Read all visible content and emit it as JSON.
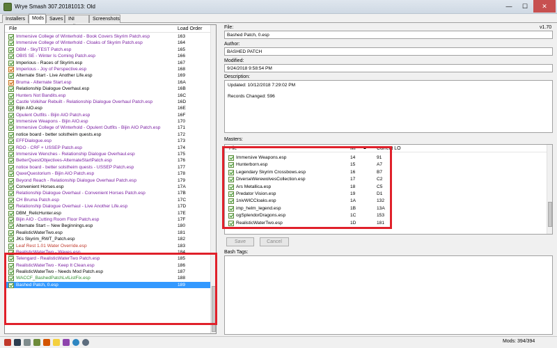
{
  "window": {
    "title": "Wrye Smash 307.20181013: Old",
    "min": "—",
    "max": "☐",
    "close": "✕"
  },
  "tabs": [
    "Installers",
    "Mods",
    "Saves",
    "INI Edits",
    "Screenshots"
  ],
  "list": {
    "col_file": "File",
    "col_lo": "Load Order",
    "rows": [
      {
        "name": "Immersive College of Winterhold - Book Covers Skyrim Patch.esp",
        "lo": "163",
        "color": "#7a1fa2",
        "check": "green"
      },
      {
        "name": "Immersive College of Winterhold - Cloaks of Skyrim Patch.esp",
        "lo": "164",
        "color": "#7a1fa2",
        "check": "green"
      },
      {
        "name": "DBM - SkyTEST Patch.esp",
        "lo": "165",
        "color": "#7a1fa2",
        "check": "green"
      },
      {
        "name": "OBIS SE - Winter Is Coming Patch.esp",
        "lo": "166",
        "color": "#7a1fa2",
        "check": "green"
      },
      {
        "name": "Imperious - Races of Skyrim.esp",
        "lo": "167",
        "color": "#000000",
        "check": "green"
      },
      {
        "name": "Imperious - Joy of Perspective.esp",
        "lo": "168",
        "color": "#7a1fa2",
        "check": "orange"
      },
      {
        "name": "Alternate Start - Live Another Life.esp",
        "lo": "169",
        "color": "#000000",
        "check": "green"
      },
      {
        "name": "Bruma - Alternate Start.esp",
        "lo": "16A",
        "color": "#7a1fa2",
        "check": "orange"
      },
      {
        "name": "Relationship Dialogue Overhaul.esp",
        "lo": "16B",
        "color": "#000000",
        "check": "green"
      },
      {
        "name": "Hunters Not Bandits.esp",
        "lo": "16C",
        "color": "#7a1fa2",
        "check": "green"
      },
      {
        "name": "Castle Volkihar Rebuilt - Relationship Dialogue Overhaul Patch.esp",
        "lo": "16D",
        "color": "#7a1fa2",
        "check": "green"
      },
      {
        "name": "Bijin AIO.esp",
        "lo": "16E",
        "color": "#000000",
        "check": "green"
      },
      {
        "name": "Opulent Outfits - Bijin AIO Patch.esp",
        "lo": "16F",
        "color": "#7a1fa2",
        "check": "green"
      },
      {
        "name": "Immersive Weapons - Bijin AIO.esp",
        "lo": "170",
        "color": "#7a1fa2",
        "check": "green"
      },
      {
        "name": "Immersive College of Winterhold - Opulent Outfits - Bijin AIO Patch.esp",
        "lo": "171",
        "color": "#7a1fa2",
        "check": "green"
      },
      {
        "name": "notice board - better solstheim quests.esp",
        "lo": "172",
        "color": "#000000",
        "check": "green"
      },
      {
        "name": "EFFDialogue.esp",
        "lo": "173",
        "color": "#7a1fa2",
        "check": "green"
      },
      {
        "name": "RDO - CRF + USSEP Patch.esp",
        "lo": "174",
        "color": "#7a1fa2",
        "check": "green"
      },
      {
        "name": "Immersive Wenches - Relationship Dialogue Overhaul.esp",
        "lo": "175",
        "color": "#7a1fa2",
        "check": "green"
      },
      {
        "name": "BetterQuestObjectives-AlternateStartPatch.esp",
        "lo": "176",
        "color": "#7a1fa2",
        "check": "green"
      },
      {
        "name": "notice board - better solstheim quests - USSEP Patch.esp",
        "lo": "177",
        "color": "#7a1fa2",
        "check": "green"
      },
      {
        "name": "QaxeQuestorium - Bijin AIO Patch.esp",
        "lo": "178",
        "color": "#7a1fa2",
        "check": "green"
      },
      {
        "name": "Beyond Reach - Relationship Dialogue Overhaul Patch.esp",
        "lo": "179",
        "color": "#7a1fa2",
        "check": "green"
      },
      {
        "name": "Convenient Horses.esp",
        "lo": "17A",
        "color": "#000000",
        "check": "green"
      },
      {
        "name": "Relationship Dialogue Overhaul - Convenient Horses Patch.esp",
        "lo": "17B",
        "color": "#7a1fa2",
        "check": "green"
      },
      {
        "name": "CH Bruma Patch.esp",
        "lo": "17C",
        "color": "#7a1fa2",
        "check": "green"
      },
      {
        "name": "Relationship Dialogue Overhaul - Live Another Life.esp",
        "lo": "17D",
        "color": "#7a1fa2",
        "check": "green"
      },
      {
        "name": "DBM_RelicHunter.esp",
        "lo": "17E",
        "color": "#000000",
        "check": "green"
      },
      {
        "name": "Bijin AIO - Cutting Room Floor Patch.esp",
        "lo": "17F",
        "color": "#7a1fa2",
        "check": "green"
      },
      {
        "name": "Alternate Start -- New Beginnings.esp",
        "lo": "180",
        "color": "#000000",
        "check": "green"
      },
      {
        "name": "RealisticWaterTwo.esp",
        "lo": "181",
        "color": "#000000",
        "check": "green"
      },
      {
        "name": "JKs Skyrim_RWT_Patch.esp",
        "lo": "182",
        "color": "#000000",
        "check": "green"
      },
      {
        "name": "Leaf Rest 1.01 Water Override.esp",
        "lo": "183",
        "color": "#c0392b",
        "check": "green"
      },
      {
        "name": "RealisticWaterTwo - Waves.esp",
        "lo": "184",
        "color": "#7a1fa2",
        "check": "green"
      },
      {
        "name": "Telengard - RealisticWaterTwo Patch.esp",
        "lo": "185",
        "color": "#7a1fa2",
        "check": "green"
      },
      {
        "name": "RealisticWaterTwo - Keep It Clean.esp",
        "lo": "186",
        "color": "#7a1fa2",
        "check": "green"
      },
      {
        "name": "RealisticWaterTwo - Needs Mod Patch.esp",
        "lo": "187",
        "color": "#000000",
        "check": "green"
      },
      {
        "name": "WACCF_BashedPatchLvlListFix.esp",
        "lo": "188",
        "color": "#2e8b2e",
        "check": "green"
      },
      {
        "name": "Bashed Patch, 0.esp",
        "lo": "189",
        "color": "#ffffff",
        "check": "green",
        "selected": true
      }
    ]
  },
  "details": {
    "file_label": "File:",
    "version": "v1.70",
    "file_value": "Bashed Patch, 0.esp",
    "author_label": "Author:",
    "author_value": "BASHED PATCH",
    "modified_label": "Modified:",
    "modified_value": "9/24/2018 9:58:54 PM",
    "description_label": "Description:",
    "description_line1": "Updated: 10/12/2018 7:29:02 PM",
    "description_line2": "Records Changed: 596",
    "masters_label": "Masters:",
    "bash_tags_label": "Bash Tags:",
    "save_button": "Save",
    "cancel_button": "Cancel"
  },
  "masters": {
    "col_file": "File",
    "col_mi": "MI",
    "col_sort": "▲",
    "col_lo": "Current LO",
    "rows": [
      {
        "name": "Immersive Weapons.esp",
        "mi": "14",
        "lo": "91"
      },
      {
        "name": "Hunterborn.esp",
        "mi": "15",
        "lo": "A7"
      },
      {
        "name": "Legendary Skyrim Crossbows.esp",
        "mi": "16",
        "lo": "B7"
      },
      {
        "name": "DiverseWerewolvesCollection.esp",
        "mi": "17",
        "lo": "C2"
      },
      {
        "name": "Ars Metallica.esp",
        "mi": "18",
        "lo": "C5"
      },
      {
        "name": "Predator Vision.esp",
        "mi": "19",
        "lo": "D1"
      },
      {
        "name": "1nivWICCloaks.esp",
        "mi": "1A",
        "lo": "132"
      },
      {
        "name": "imp_helm_legend.esp",
        "mi": "1B",
        "lo": "13A"
      },
      {
        "name": "ogSplendorDragons.esp",
        "mi": "1C",
        "lo": "153"
      },
      {
        "name": "RealisticWaterTwo.esp",
        "mi": "1D",
        "lo": "181"
      }
    ]
  },
  "status": {
    "mods_count": "Mods: 394/394"
  },
  "colors": {
    "selection": "#3399ff",
    "highlight_box": "#e0202a",
    "esm_purple": "#7a1fa2"
  }
}
